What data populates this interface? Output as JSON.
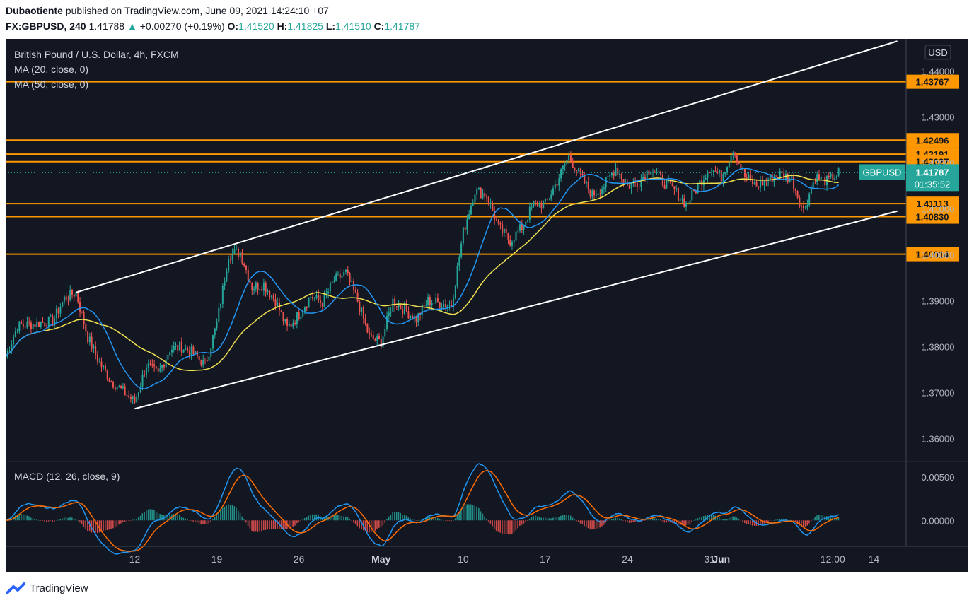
{
  "header": {
    "author": "Dubaotiente",
    "published_text": "published on TradingView.com, June 09, 2021 14:24:10 +07",
    "symbol": "FX:GBPUSD, 240",
    "last": "1.41788",
    "change_arrow": "▲",
    "change": "+0.00270 (+0.19%)",
    "o_label": "O:",
    "o_value": "1.41520",
    "h_label": "H:",
    "h_value": "1.41825",
    "l_label": "L:",
    "l_value": "1.41510",
    "c_label": "C:",
    "c_value": "1.41787"
  },
  "legend": {
    "instrument": "British Pound / U.S. Dollar, 4h, FXCM",
    "ma20": "MA (20, close, 0)",
    "ma50": "MA (50, close, 0)",
    "macd": "MACD (12, 26, close, 9)"
  },
  "footer": {
    "brand": "TradingView",
    "logo_icon": "tradingview-logo-icon"
  },
  "colors": {
    "background": "#131722",
    "up": "#26a69a",
    "down": "#ef5350",
    "ma20": "#2196f3",
    "ma50": "#f2e24e",
    "level": "#ff9800",
    "channel": "#ffffff",
    "macd_line": "#2196f3",
    "signal_line": "#ff6d00",
    "last_price_tag": "#26a69a"
  },
  "chart_data": {
    "type": "candlestick",
    "currency_label": "USD",
    "price_axis": {
      "ylim": [
        1.355,
        1.447
      ],
      "ticks": [
        "1.44000",
        "1.43000",
        "1.42000",
        "1.41000",
        "1.40000",
        "1.39000",
        "1.38000",
        "1.37000",
        "1.36000"
      ]
    },
    "time_axis": {
      "ticks": [
        "12",
        "19",
        "26",
        "May",
        "10",
        "17",
        "24",
        "31",
        "Jun",
        "12:00",
        "14"
      ]
    },
    "last_price": {
      "symbol": "GBPUSD",
      "value": "1.41787",
      "countdown": "01:35:52"
    },
    "horizontal_levels": [
      1.43767,
      1.42496,
      1.42191,
      1.42027,
      1.41113,
      1.4083,
      1.40014
    ],
    "level_labels": [
      "1.43767",
      "1.42496",
      "1.42191",
      "1.42027",
      "1.41113",
      "1.40830",
      "1.40014"
    ],
    "channel": {
      "upper": {
        "from": [
          "2021-04-07",
          1.3918
        ],
        "to": [
          "2021-06-16",
          1.4465
        ]
      },
      "lower": {
        "from": [
          "2021-04-12",
          1.3665
        ],
        "to": [
          "2021-06-16",
          1.4095
        ]
      }
    },
    "price_path_keypoints": [
      [
        "2021-04-01",
        1.3778
      ],
      [
        "2021-04-02",
        1.3845
      ],
      [
        "2021-04-05",
        1.3855
      ],
      [
        "2021-04-06",
        1.3905
      ],
      [
        "2021-04-07",
        1.3918
      ],
      [
        "2021-04-08",
        1.382
      ],
      [
        "2021-04-09",
        1.3765
      ],
      [
        "2021-04-10",
        1.3725
      ],
      [
        "2021-04-12",
        1.368
      ],
      [
        "2021-04-13",
        1.376
      ],
      [
        "2021-04-14",
        1.374
      ],
      [
        "2021-04-15",
        1.3795
      ],
      [
        "2021-04-16",
        1.38
      ],
      [
        "2021-04-17",
        1.3785
      ],
      [
        "2021-04-18",
        1.376
      ],
      [
        "2021-04-19",
        1.385
      ],
      [
        "2021-04-20",
        1.4
      ],
      [
        "2021-04-21",
        1.4005
      ],
      [
        "2021-04-22",
        1.393
      ],
      [
        "2021-04-23",
        1.3935
      ],
      [
        "2021-04-24",
        1.39
      ],
      [
        "2021-04-25",
        1.384
      ],
      [
        "2021-04-26",
        1.387
      ],
      [
        "2021-04-27",
        1.391
      ],
      [
        "2021-04-28",
        1.3895
      ],
      [
        "2021-04-29",
        1.3945
      ],
      [
        "2021-04-30",
        1.396
      ],
      [
        "2021-05-01",
        1.39
      ],
      [
        "2021-05-02",
        1.382
      ],
      [
        "2021-05-03",
        1.381
      ],
      [
        "2021-05-04",
        1.39
      ],
      [
        "2021-05-05",
        1.388
      ],
      [
        "2021-05-06",
        1.386
      ],
      [
        "2021-05-07",
        1.39
      ],
      [
        "2021-05-08",
        1.3895
      ],
      [
        "2021-05-09",
        1.389
      ],
      [
        "2021-05-10",
        1.405
      ],
      [
        "2021-05-11",
        1.414
      ],
      [
        "2021-05-12",
        1.413
      ],
      [
        "2021-05-13",
        1.406
      ],
      [
        "2021-05-14",
        1.403
      ],
      [
        "2021-05-15",
        1.406
      ],
      [
        "2021-05-16",
        1.411
      ],
      [
        "2021-05-17",
        1.411
      ],
      [
        "2021-05-18",
        1.416
      ],
      [
        "2021-05-19",
        1.4215
      ],
      [
        "2021-05-20",
        1.417
      ],
      [
        "2021-05-21",
        1.413
      ],
      [
        "2021-05-22",
        1.415
      ],
      [
        "2021-05-23",
        1.419
      ],
      [
        "2021-05-24",
        1.415
      ],
      [
        "2021-05-25",
        1.416
      ],
      [
        "2021-05-26",
        1.419
      ],
      [
        "2021-05-27",
        1.416
      ],
      [
        "2021-05-28",
        1.414
      ],
      [
        "2021-05-29",
        1.411
      ],
      [
        "2021-05-30",
        1.415
      ],
      [
        "2021-05-31",
        1.419
      ],
      [
        "2021-06-01",
        1.417
      ],
      [
        "2021-06-02",
        1.423
      ],
      [
        "2021-06-03",
        1.417
      ],
      [
        "2021-06-04",
        1.415
      ],
      [
        "2021-06-05",
        1.4165
      ],
      [
        "2021-06-06",
        1.4175
      ],
      [
        "2021-06-07",
        1.4165
      ],
      [
        "2021-06-08",
        1.4095
      ],
      [
        "2021-06-09",
        1.417
      ],
      [
        "2021-06-10",
        1.416
      ],
      [
        "2021-06-11",
        1.4178
      ]
    ],
    "macd_axis": {
      "ticks": [
        "0.00500",
        "0.00000"
      ]
    }
  }
}
